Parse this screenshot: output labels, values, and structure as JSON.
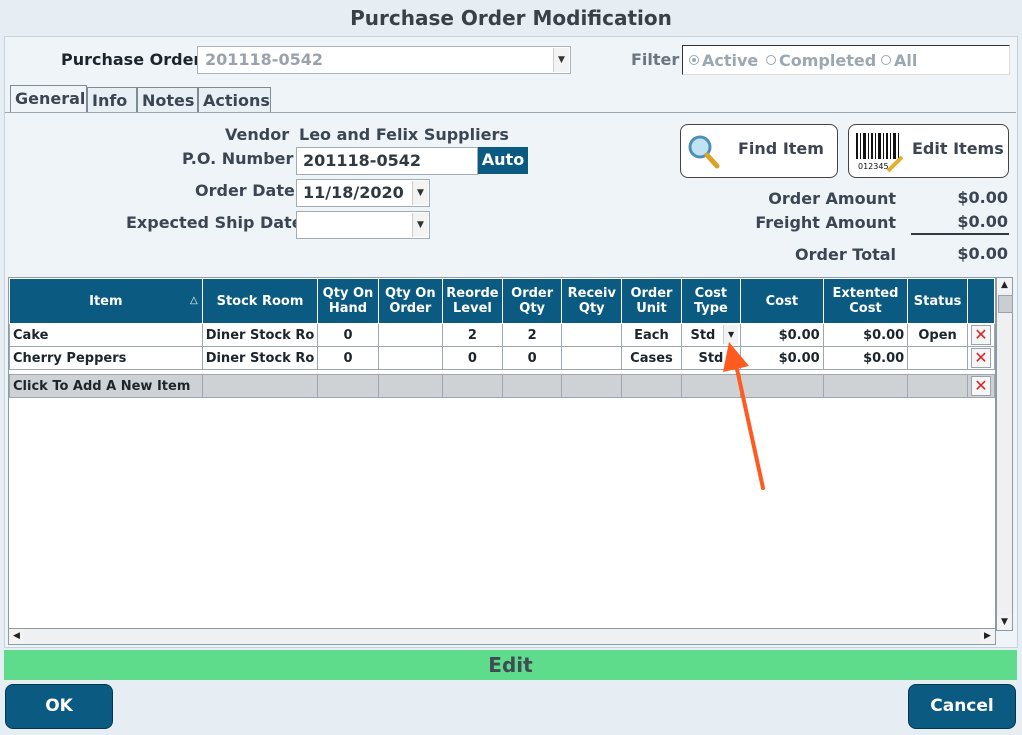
{
  "window": {
    "title": "Purchase Order Modification"
  },
  "header": {
    "po_label": "Purchase Order",
    "po_value": "201118-0542",
    "filter_label": "Filter",
    "filter_options": [
      "Active",
      "Completed",
      "All"
    ],
    "filter_selected": "Active"
  },
  "tabs": [
    "General",
    "Info",
    "Notes",
    "Actions"
  ],
  "general": {
    "vendor_label": "Vendor",
    "vendor_value": "Leo and Felix Suppliers",
    "po_number_label": "P.O. Number",
    "po_number_value": "201118-0542",
    "auto_label": "Auto",
    "order_date_label": "Order Date",
    "order_date_value": "11/18/2020",
    "expected_ship_label": "Expected Ship Date",
    "expected_ship_value": ""
  },
  "toolbar": {
    "find_item": "Find Item",
    "edit_items": "Edit Items",
    "barcode_digits": "012345"
  },
  "totals": {
    "order_amount_label": "Order Amount",
    "order_amount": "$0.00",
    "freight_label": "Freight Amount",
    "freight": "$0.00",
    "total_label": "Order Total",
    "total": "$0.00"
  },
  "grid": {
    "columns": [
      "Item",
      "Stock Room",
      "Qty On Hand",
      "Qty On Order",
      "Reorde Level",
      "Order Qty",
      "Receiv Qty",
      "Order Unit",
      "Cost Type",
      "Cost",
      "Extented Cost",
      "Status"
    ],
    "sort_indicator": "△",
    "rows": [
      {
        "item": "Cake",
        "stock_room": "Diner Stock Ro",
        "qty_on_hand": "0",
        "qty_on_order": "",
        "reorder_level": "2",
        "order_qty": "2",
        "receiv_qty": "",
        "order_unit": "Each",
        "cost_type": "Std",
        "cost": "$0.00",
        "extended_cost": "$0.00",
        "status": "Open"
      },
      {
        "item": "Cherry Peppers",
        "stock_room": "Diner Stock Ro",
        "qty_on_hand": "0",
        "qty_on_order": "",
        "reorder_level": "0",
        "order_qty": "0",
        "receiv_qty": "",
        "order_unit": "Cases",
        "cost_type": "Std",
        "cost": "$0.00",
        "extended_cost": "$0.00",
        "status": ""
      }
    ],
    "add_row_label": "Click To Add A New Item"
  },
  "status_bar": {
    "mode": "Edit"
  },
  "buttons": {
    "ok": "OK",
    "cancel": "Cancel"
  },
  "colors": {
    "accent": "#0b5a82",
    "status_bar": "#5edc8c",
    "arrow": "#ff5a1f"
  }
}
